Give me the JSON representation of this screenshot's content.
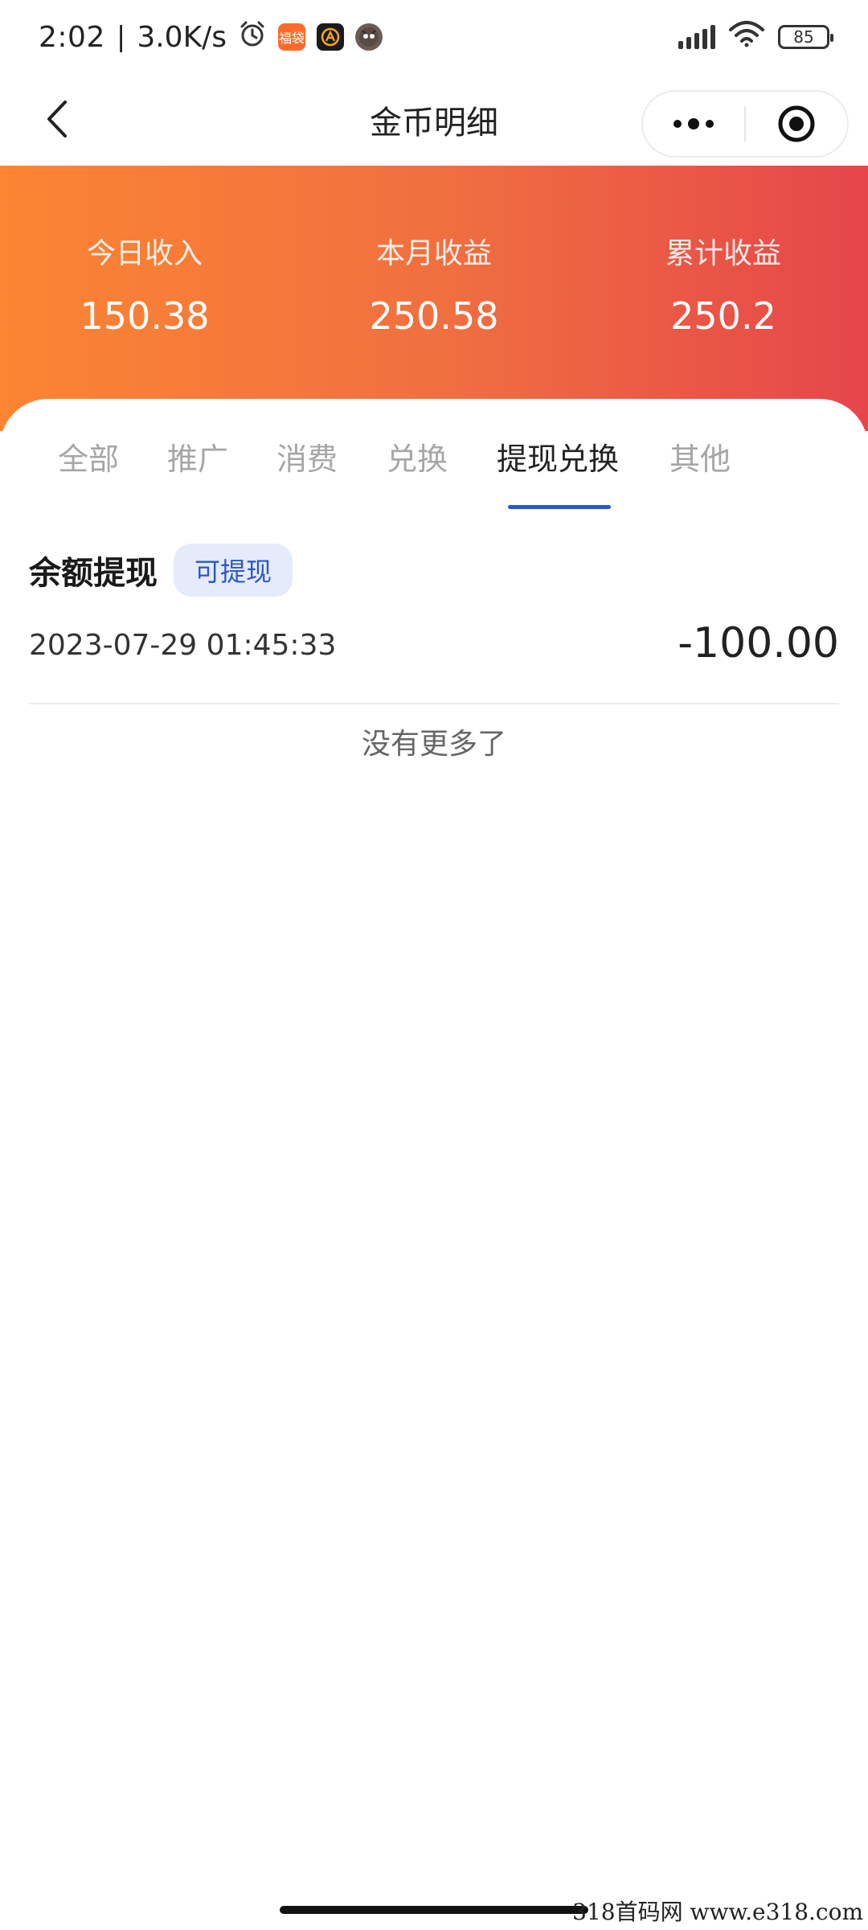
{
  "status_bar": {
    "time": "2:02",
    "speed": "3.0K/s",
    "battery": "85",
    "app_badge_1": "福袋"
  },
  "nav": {
    "title": "金币明细"
  },
  "stats": [
    {
      "label": "今日收入",
      "value": "150.38"
    },
    {
      "label": "本月收益",
      "value": "250.58"
    },
    {
      "label": "累计收益",
      "value": "250.2"
    }
  ],
  "tabs": [
    {
      "label": "全部",
      "active": false
    },
    {
      "label": "推广",
      "active": false
    },
    {
      "label": "消费",
      "active": false
    },
    {
      "label": "兑换",
      "active": false
    },
    {
      "label": "提现兑换",
      "active": true
    },
    {
      "label": "其他",
      "active": false
    }
  ],
  "records": [
    {
      "title": "余额提现",
      "tag": "可提现",
      "time": "2023-07-29 01:45:33",
      "amount": "-100.00"
    }
  ],
  "footer": {
    "no_more": "没有更多了",
    "watermark": "318首码网   www.e318.com"
  },
  "colors": {
    "accent": "#2b57c9",
    "gradient_start": "#fb8533",
    "gradient_end": "#e5464a"
  }
}
